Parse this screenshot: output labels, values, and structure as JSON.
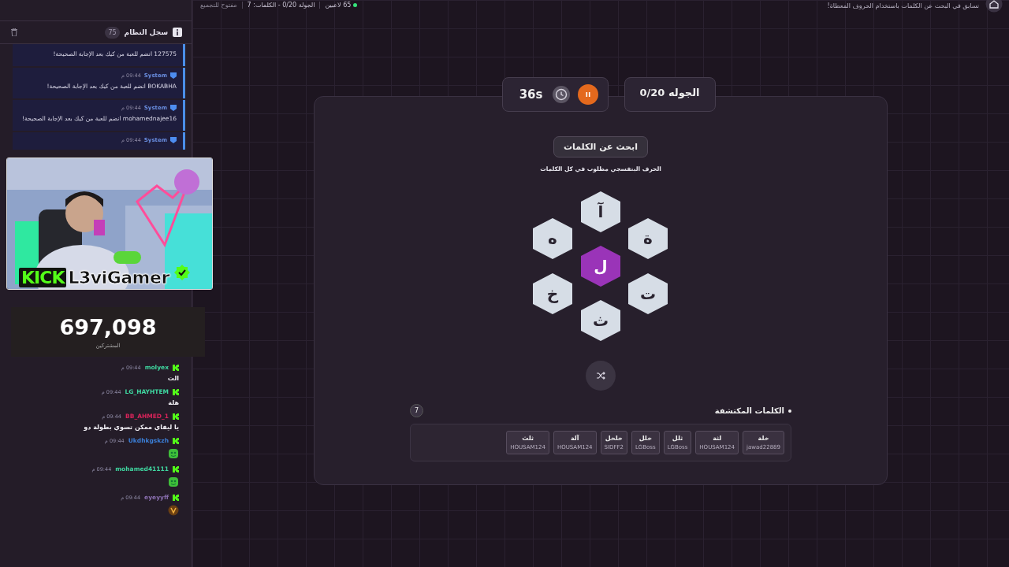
{
  "top_bar": {
    "subtitle": "تسابق في البحث عن الكلمات باستخدام الحروف المعطاة!",
    "players": "65 لاعبين",
    "round_info": "الجولة 0/20 - الكلمات: 7",
    "status": "مفتوح للتجميع"
  },
  "system_log": {
    "title": "سجل النظام",
    "count": "75",
    "entries": [
      {
        "text": "127575 انضم للعبة من كيك بعد الإجابة الصحيحة!"
      },
      {
        "sender": "System",
        "time": "09:44 م",
        "text": "BOKABHA انضم للعبة من كيك بعد الإجابة الصحيحة!"
      },
      {
        "sender": "System",
        "time": "09:44 م",
        "text": "mohamednajee16 انضم للعبة من كيك بعد الإجابة الصحيحة!"
      },
      {
        "sender": "System",
        "time": "09:44 م"
      }
    ]
  },
  "stream_overlay": {
    "kind": "picture",
    "brand": "KICK",
    "channel": "L3viGamer",
    "verified": true,
    "followers": "697,098",
    "followers_label": "المشتركين"
  },
  "chat": [
    {
      "user": "molyex",
      "color": "#3fd7a0",
      "time": "09:44 م",
      "kind": "text",
      "text": "الت"
    },
    {
      "user": "LG_HAYHTEM",
      "color": "#3fd7a0",
      "time": "09:44 م",
      "kind": "text",
      "text": "هلة"
    },
    {
      "user": "BB_AHMED_1",
      "color": "#d8245a",
      "time": "09:44 م",
      "kind": "text",
      "text": "يا ليفاي ممكن تسوي بطولة دو"
    },
    {
      "user": "Ukdhkgskzh",
      "color": "#3b7fd8",
      "time": "09:44 م",
      "kind": "emote"
    },
    {
      "user": "mohamed41111",
      "color": "#3fd7a0",
      "time": "09:44 م",
      "kind": "emote"
    },
    {
      "user": "eyeyyff",
      "color": "#8a6fb0",
      "time": "09:44 م",
      "kind": "badge"
    }
  ],
  "game": {
    "round": "الجوله 0/20",
    "timer": "36s",
    "paused": true,
    "title": "ابحث عن الكلمات",
    "hint": "الحرف البنفسجي مطلوب في كل الكلمات",
    "letters": [
      {
        "letter": "آ",
        "selected": false
      },
      {
        "letter": "ة",
        "selected": false
      },
      {
        "letter": "ت",
        "selected": false
      },
      {
        "letter": "ث",
        "selected": false
      },
      {
        "letter": "خ",
        "selected": false
      },
      {
        "letter": "ه",
        "selected": false
      },
      {
        "letter": "ل",
        "selected": true
      }
    ],
    "found_title": "الكلمات المكتشفة",
    "found_count": "7",
    "found_words": [
      {
        "word": "خلة",
        "player": "jawad22889"
      },
      {
        "word": "لثة",
        "player": "HOUSAM124"
      },
      {
        "word": "ثلل",
        "player": "LGBoss"
      },
      {
        "word": "خلل",
        "player": "LGBoss"
      },
      {
        "word": "خلخل",
        "player": "SIDFF2"
      },
      {
        "word": "آلة",
        "player": "HOUSAM124"
      },
      {
        "word": "ثلث",
        "player": "HOUSAM124"
      }
    ]
  }
}
